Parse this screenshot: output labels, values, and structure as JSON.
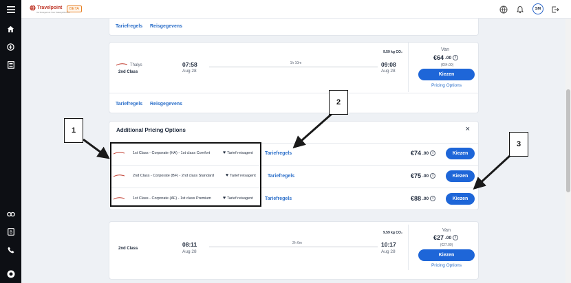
{
  "app": {
    "logo_text": "Travelpoint",
    "logo_subtext": "Uw Reisgenoot Voor Zakelijk Reizen",
    "beta_badge": "BETA",
    "user_initials": "SM"
  },
  "colors": {
    "accent": "#1e66d8",
    "link": "#2a6ec9",
    "sidebar": "#0d0f14",
    "beta": "#e67e22"
  },
  "sidebar": {
    "icons": [
      "menu-icon",
      "home-icon",
      "plus-circle-icon",
      "list-icon",
      "link-icon",
      "bill-icon",
      "phone-icon",
      "profile-icon"
    ]
  },
  "top_card": {
    "link_rules": "Tariefregels",
    "link_travel": "Reisgegevens"
  },
  "thalys_card": {
    "carrier": "Thalys",
    "class": "2nd Class",
    "dep_time": "07:58",
    "dep_date": "Aug 28",
    "duration": "1h 10m",
    "arr_time": "09:08",
    "arr_date": "Aug 28",
    "co2": "9.59 kg CO₂",
    "van": "Van",
    "price_main": "€64",
    "price_cents": ".00",
    "price_sub": "(€64.00)",
    "button": "Kiezen",
    "pricing_options": "Pricing Options",
    "link_rules": "Tariefregels",
    "link_travel": "Reisgegevens"
  },
  "additional": {
    "title": "Additional Pricing Options",
    "close": "×",
    "options": [
      {
        "label": "1st Class - Corporate (HA) - 1st class Comfort",
        "tarief": "Tarief reisagent",
        "rules": "Tariefregels",
        "price_main": "€74",
        "price_cents": ".00",
        "button": "Kiezen"
      },
      {
        "label": "2nd Class - Corporate (BF) - 2nd class Standard",
        "tarief": "Tarief reisagent",
        "rules": "Tariefregels",
        "price_main": "€75",
        "price_cents": ".00",
        "button": "Kiezen"
      },
      {
        "label": "1st Class - Corporate (AF) - 1st class Premium",
        "tarief": "Tarief reisagent",
        "rules": "Tariefregels",
        "price_main": "€88",
        "price_cents": ".00",
        "button": "Kiezen"
      }
    ]
  },
  "bottom_card": {
    "class": "2nd Class",
    "dep_time": "08:11",
    "dep_date": "Aug 28",
    "duration": "2h 6m",
    "arr_time": "10:17",
    "arr_date": "Aug 28",
    "co2": "9.59 kg CO₂",
    "van": "Van",
    "price_main": "€27",
    "price_cents": ".00",
    "price_sub": "(€27.00)",
    "button": "Kiezen",
    "pricing_options": "Pricing Options"
  },
  "callouts": [
    "1",
    "2",
    "3"
  ]
}
